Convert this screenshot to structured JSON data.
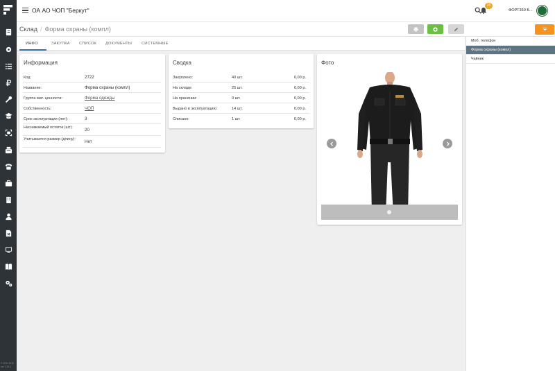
{
  "app": {
    "org_name": "ОА АО ЧОП \"Беркут\"",
    "notifications_count": "20",
    "user_name": "ФОРТ360 Б...",
    "footer_line1": "© 2024 DDE",
    "footer_line2": "ver 1.28.1"
  },
  "sidebar": {
    "icons": [
      "logo-icon",
      "clipboard-icon",
      "gear-small-icon",
      "list-icon",
      "ruble-icon",
      "wrench-icon",
      "graduation-icon",
      "scan-icon",
      "fax-icon",
      "phone-icon",
      "briefcase-icon",
      "building-icon",
      "user-icon",
      "document-x-icon",
      "monitor-icon",
      "book-icon",
      "settings-icon"
    ]
  },
  "breadcrumb": {
    "root": "Склад",
    "current": "Форма охраны (компл)"
  },
  "toolbar": {
    "print_icon": "print-icon",
    "add_icon": "plus-icon",
    "edit_icon": "pencil-icon",
    "filter_icon": "filter-icon",
    "add_color": "#6cbf42",
    "filter_color": "#f6921e"
  },
  "tabs": [
    "ИНФО",
    "ЗАКУПКА",
    "СПИСОК",
    "ДОКУМЕНТЫ",
    "СИСТЕМНЫЕ"
  ],
  "info": {
    "title": "Информация",
    "rows": [
      {
        "label": "Код:",
        "value": "2722"
      },
      {
        "label": "Название:",
        "value": "Форма охраны (компл)"
      },
      {
        "label": "Группа мат. ценности:",
        "value": "Форма одежды"
      },
      {
        "label": "Собственность:",
        "value": "ЧОП"
      },
      {
        "label": "Срок эксплуатации (лет):",
        "value": "3"
      },
      {
        "label": "Неснижаемый остаток (шт):",
        "value": "20"
      },
      {
        "label": "Учитывается размер (длину):",
        "value": "Нет"
      }
    ]
  },
  "summary": {
    "title": "Сводка",
    "rows": [
      {
        "label": "Закуплено:",
        "qty": "40 шт.",
        "amount": "0,00 р."
      },
      {
        "label": "На складе:",
        "qty": "25 шт.",
        "amount": "0,00 р."
      },
      {
        "label": "На хранении:",
        "qty": "0 шт.",
        "amount": "0,00 р."
      },
      {
        "label": "Выдано в эксплуатацию:",
        "qty": "14 шт.",
        "amount": "0,00 р."
      },
      {
        "label": "Списано:",
        "qty": "1 шт.",
        "amount": "0,00 р."
      }
    ]
  },
  "photo": {
    "title": "Фото"
  },
  "right_panel": {
    "items": [
      "Моб. телефон",
      "Форма охраны (компл)",
      "Чайник"
    ]
  }
}
